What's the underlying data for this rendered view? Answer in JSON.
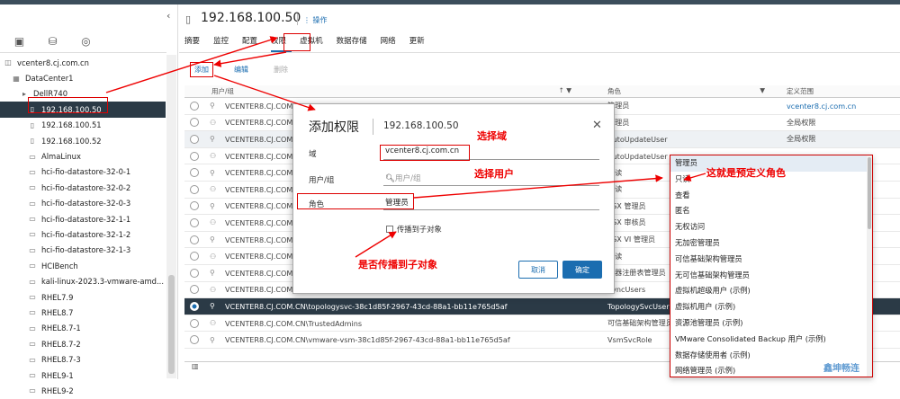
{
  "header": {
    "title": "192.168.100.50",
    "actions_label": "操作",
    "tabs": [
      "摘要",
      "监控",
      "配置",
      "权限",
      "虚拟机",
      "数据存储",
      "网络",
      "更新"
    ]
  },
  "toolbar": {
    "add": "添加",
    "edit": "编辑",
    "delete": "删除"
  },
  "sidebar": {
    "collapse_icon": "chevron-left-icon",
    "view_icons": [
      "hosts-clusters-icon",
      "storage-icon",
      "network-icon"
    ],
    "tree": [
      "vcenter8.cj.com.cn",
      "DataCenter1",
      "DellR740",
      "192.168.100.50",
      "192.168.100.51",
      "192.168.100.52",
      "AlmaLinux",
      "hci-fio-datastore-32-0-1",
      "hci-fio-datastore-32-0-2",
      "hci-fio-datastore-32-0-3",
      "hci-fio-datastore-32-1-1",
      "hci-fio-datastore-32-1-2",
      "hci-fio-datastore-32-1-3",
      "HCIBench",
      "kali-linux-2023.3-vmware-amd...",
      "RHEL7.9",
      "RHEL8.7",
      "RHEL8.7-1",
      "RHEL8.7-2",
      "RHEL8.7-3",
      "RHEL9-1",
      "RHEL9-2"
    ]
  },
  "table": {
    "columns": [
      "用户/组",
      "角色",
      "定义范围"
    ],
    "rows": [
      {
        "user": "VCENTER8.CJ.COM.CN\\vpxd-extension-...",
        "role": "管理员",
        "scope": "vcenter8.cj.com.cn"
      },
      {
        "user": "VCENTER8.CJ.COM.CN\\...",
        "role": "管理员",
        "scope": "全局权限"
      },
      {
        "user": "VCENTER8.CJ.COM.CN\\...",
        "role": "AutoUpdateUser",
        "scope": "全局权限"
      },
      {
        "user": "VCENTER8.CJ.COM.CN\\...",
        "role": "AutoUpdateUser",
        "scope": ""
      },
      {
        "user": "VCENTER8.CJ.COM.CN\\...",
        "role": "只读",
        "scope": ""
      },
      {
        "user": "VCENTER8.CJ.COM.CN\\...",
        "role": "只读",
        "scope": ""
      },
      {
        "user": "VCENTER8.CJ.COM.CN\\...",
        "role": "ESX 管理员",
        "scope": ""
      },
      {
        "user": "VCENTER8.CJ.COM.CN\\...",
        "role": "ESX 审核员",
        "scope": ""
      },
      {
        "user": "VCENTER8.CJ.COM.CN\\...",
        "role": "ESX VI 管理员",
        "scope": ""
      },
      {
        "user": "VCENTER8.CJ.COM.CN\\...",
        "role": "只读",
        "scope": ""
      },
      {
        "user": "VCENTER8.CJ.COM.CN\\...",
        "role": "容器注册表管理员",
        "scope": ""
      },
      {
        "user": "VCENTER8.CJ.COM.CN\\SyncUsers",
        "role": "SyncUsers",
        "scope": ""
      },
      {
        "user": "VCENTER8.CJ.COM.CN\\topologysvc-38c1d85f-2967-43cd-88a1-bb11e765d5af",
        "role": "TopologySvcUser",
        "scope": ""
      },
      {
        "user": "VCENTER8.CJ.COM.CN\\TrustedAdmins",
        "role": "可信基础架构管理员",
        "scope": ""
      },
      {
        "user": "VCENTER8.CJ.COM.CN\\vmware-vsm-38c1d85f-2967-43cd-88a1-bb11e765d5af",
        "role": "VsmSvcRole",
        "scope": ""
      }
    ]
  },
  "modal": {
    "title": "添加权限",
    "subtitle": "192.168.100.50",
    "domain_label": "域",
    "domain_value": "vcenter8.cj.com.cn",
    "user_label": "用户/组",
    "user_placeholder": "用户/组",
    "role_label": "角色",
    "role_value": "管理员",
    "propagate_label": "传播到子对象",
    "cancel": "取消",
    "ok": "确定"
  },
  "role_dropdown": [
    "管理员",
    "只读",
    "查看",
    "匿名",
    "无权访问",
    "无加密管理员",
    "可信基础架构管理员",
    "无可信基础架构管理员",
    "虚拟机超级用户 (示例)",
    "虚拟机用户 (示例)",
    "资源池管理员 (示例)",
    "VMware Consolidated Backup 用户 (示例)",
    "数据存储使用者 (示例)",
    "网络管理员 (示例)"
  ],
  "annotations": {
    "select_domain": "选择域",
    "select_user": "选择用户",
    "propagate": "是否传播到子对象",
    "predefined_roles": "这就是预定义角色"
  },
  "watermark": "鑫坤畅连",
  "colors": {
    "accent": "#1b6db0",
    "selected_row": "#2b3a46",
    "annotation": "#e00000"
  }
}
